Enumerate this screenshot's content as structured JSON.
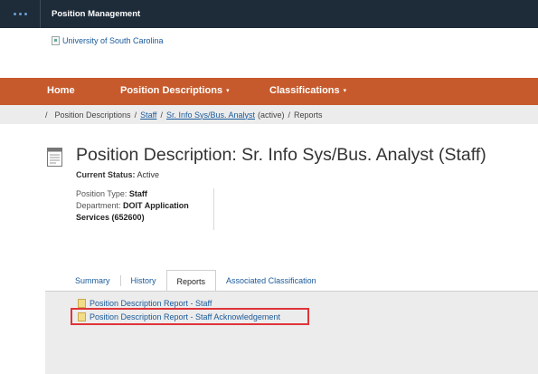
{
  "topbar": {
    "title": "Position Management"
  },
  "logo": {
    "alt_text": "University of South Carolina"
  },
  "nav": {
    "items": [
      {
        "label": "Home"
      },
      {
        "label": "Position Descriptions"
      },
      {
        "label": "Classifications"
      }
    ]
  },
  "breadcrumb": {
    "root": "Position Descriptions",
    "level2": "Staff",
    "level3": "Sr. Info Sys/Bus. Analyst",
    "level3_suffix": "(active)",
    "current": "Reports",
    "separator": "/"
  },
  "header": {
    "title": "Position Description: Sr. Info Sys/Bus. Analyst (Staff)",
    "status_label": "Current Status:",
    "status_value": "Active"
  },
  "details": {
    "type_label": "Position Type:",
    "type_value": "Staff",
    "dept_label": "Department:",
    "dept_value": "DOIT Application Services (652600)"
  },
  "tabs": [
    {
      "label": "Summary"
    },
    {
      "label": "History"
    },
    {
      "label": "Reports"
    },
    {
      "label": "Associated Classification"
    }
  ],
  "reports": [
    {
      "label": "Position Description Report - Staff"
    },
    {
      "label": "Position Description Report - Staff Acknowledgement"
    }
  ],
  "colors": {
    "topbar": "#1e2b38",
    "nav": "#c65a2c",
    "link": "#1a5a9a",
    "highlight": "#e0343a"
  }
}
